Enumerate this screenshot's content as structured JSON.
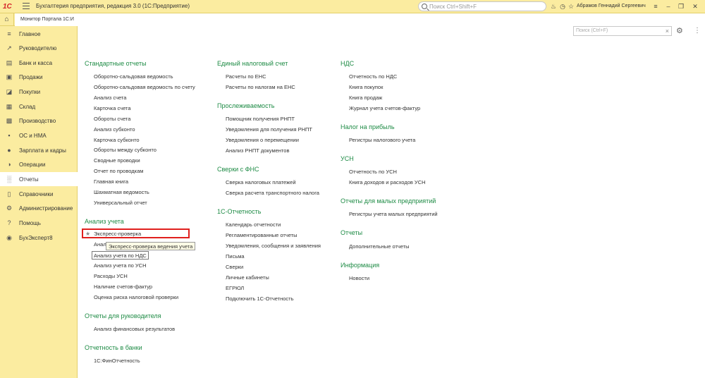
{
  "titlebar": {
    "logo": "1С",
    "app_title": "Бухгалтерия предприятия, редакция 3.0  (1С:Предприятие)",
    "search_placeholder": "Поиск Ctrl+Shift+F",
    "user_name": "Абрамов Геннадий Сергеевич"
  },
  "tabs": {
    "portal_label": "Монитор Портала 1С:И"
  },
  "sidebar": {
    "items": [
      {
        "label": "Главное",
        "icon": "menu-icon"
      },
      {
        "label": "Руководителю",
        "icon": "chart-line-icon"
      },
      {
        "label": "Банк и касса",
        "icon": "bank-icon"
      },
      {
        "label": "Продажи",
        "icon": "bag-icon"
      },
      {
        "label": "Покупки",
        "icon": "cart-icon"
      },
      {
        "label": "Склад",
        "icon": "warehouse-icon"
      },
      {
        "label": "Производство",
        "icon": "factory-icon"
      },
      {
        "label": "ОС и НМА",
        "icon": "truck-icon"
      },
      {
        "label": "Зарплата и кадры",
        "icon": "person-icon"
      },
      {
        "label": "Операции",
        "icon": "operations-icon"
      },
      {
        "label": "Отчеты",
        "icon": "bar-chart-icon"
      },
      {
        "label": "Справочники",
        "icon": "book-icon"
      },
      {
        "label": "Администрирование",
        "icon": "gear-icon"
      },
      {
        "label": "Помощь",
        "icon": "question-icon"
      },
      {
        "label": "БухЭксперт8",
        "icon": "expert-icon"
      }
    ]
  },
  "main": {
    "search_placeholder": "Поиск (Ctrl+F)",
    "col1": {
      "standard_header": "Стандартные отчеты",
      "standard": [
        "Оборотно-сальдовая ведомость",
        "Оборотно-сальдовая ведомость по счету",
        "Анализ счета",
        "Карточка счета",
        "Обороты счета",
        "Анализ субконто",
        "Карточка субконто",
        "Обороты между субконто",
        "Сводные проводки",
        "Отчет по проводкам",
        "Главная книга",
        "Шахматная ведомость",
        "Универсальный отчет"
      ],
      "analysis_header": "Анализ учета",
      "analysis_highlighted": "Экспресс-проверка",
      "analysis_partial": "Анал",
      "analysis_tooltip": "Экспресс-проверка ведения учета",
      "analysis_boxed": "Анализ учета по НДС",
      "analysis": [
        "Анализ учета по УСН",
        "Расходы УСН",
        "Наличие счетов-фактур",
        "Оценка риска налоговой проверки"
      ],
      "managers_header": "Отчеты для руководителя",
      "managers": [
        "Анализ финансовых результатов"
      ],
      "banks_header": "Отчетность в банки",
      "banks": [
        "1С:ФинОтчетность"
      ]
    },
    "col2": {
      "ens_header": "Единый налоговый счет",
      "ens": [
        "Расчеты по ЕНС",
        "Расчеты по налогам на ЕНС"
      ],
      "trace_header": "Прослеживаемость",
      "trace": [
        "Помощник получения РНПТ",
        "Уведомления для получения РНПТ",
        "Уведомления о перемещении",
        "Анализ РНПТ документов"
      ],
      "fns_header": "Сверки с ФНС",
      "fns": [
        "Сверка налоговых платежей",
        "Сверка расчета транспортного налога"
      ],
      "reporting_header": "1С-Отчетность",
      "reporting": [
        "Календарь отчетности",
        "Регламентированные отчеты",
        "Уведомления, сообщения и заявления",
        "Письма",
        "Сверки",
        "Личные кабинеты",
        "ЕГРЮЛ",
        "Подключить 1С-Отчетность"
      ]
    },
    "col3": {
      "vat_header": "НДС",
      "vat": [
        "Отчетность по НДС",
        "Книга покупок",
        "Книга продаж",
        "Журнал учета счетов-фактур"
      ],
      "profit_header": "Налог на прибыль",
      "profit": [
        "Регистры налогового учета"
      ],
      "usn_header": "УСН",
      "usn": [
        "Отчетность по УСН",
        "Книга доходов и расходов УСН"
      ],
      "small_header": "Отчеты для малых предприятий",
      "small": [
        "Регистры учета малых предприятий"
      ],
      "reports_header": "Отчеты",
      "reports": [
        "Дополнительные отчеты"
      ],
      "info_header": "Информация",
      "info": [
        "Новости"
      ]
    }
  }
}
